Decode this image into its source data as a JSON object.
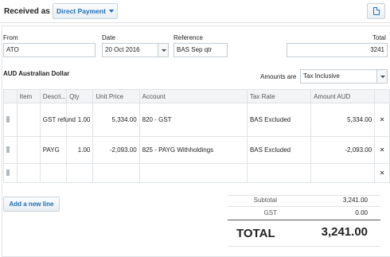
{
  "header": {
    "received_as": "Received as",
    "type_button": "Direct Payment",
    "doc_icon": "document-icon"
  },
  "form": {
    "from_label": "From",
    "from_value": "ATO",
    "date_label": "Date",
    "date_value": "20 Oct 2016",
    "reference_label": "Reference",
    "reference_value": "BAS Sep qtr",
    "total_label": "Total",
    "total_value": "3241"
  },
  "currency": "AUD Australian Dollar",
  "amounts": {
    "label": "Amounts are",
    "value": "Tax Inclusive"
  },
  "table": {
    "headers": {
      "item": "Item",
      "description": "Descri...",
      "qty": "Qty",
      "unit_price": "Unit Price",
      "account": "Account",
      "tax_rate": "Tax Rate",
      "amount": "Amount AUD"
    },
    "rows": [
      {
        "item": "",
        "description": "GST refund",
        "qty": "1.00",
        "unit_price": "5,334.00",
        "account": "820 - GST",
        "tax_rate": "BAS Excluded",
        "amount": "5,334.00"
      },
      {
        "item": "",
        "description": "PAYG",
        "qty": "1.00",
        "unit_price": "-2,093.00",
        "account": "825 - PAYG Withholdings",
        "tax_rate": "BAS Excluded",
        "amount": "-2,093.00"
      },
      {
        "item": "",
        "description": "",
        "qty": "",
        "unit_price": "",
        "account": "",
        "tax_rate": "",
        "amount": ""
      }
    ],
    "delete_glyph": "✕"
  },
  "add_line_button": "Add a new line",
  "totals": {
    "subtotal_label": "Subtotal",
    "subtotal_value": "3,241.00",
    "gst_label": "GST",
    "gst_value": "0.00",
    "total_label": "TOTAL",
    "total_value": "3,241.00"
  },
  "colors": {
    "accent": "#1f6fb5",
    "border": "#dfe3e6",
    "header_bg": "#f3f4f5"
  }
}
